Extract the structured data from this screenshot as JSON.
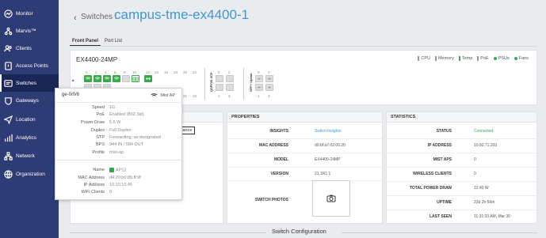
{
  "sidebar": {
    "items": [
      {
        "label": "Monitor",
        "icon": "monitor-icon",
        "active": false
      },
      {
        "label": "Marvis™",
        "icon": "marvis-icon",
        "active": false
      },
      {
        "label": "Clients",
        "icon": "clients-icon",
        "active": false
      },
      {
        "label": "Access Points",
        "icon": "access-points-icon",
        "active": false
      },
      {
        "label": "Switches",
        "icon": "switches-icon",
        "active": true
      },
      {
        "label": "Gateways",
        "icon": "gateways-icon",
        "active": false
      },
      {
        "label": "Location",
        "icon": "location-icon",
        "active": false
      },
      {
        "label": "Analytics",
        "icon": "analytics-icon",
        "active": false
      },
      {
        "label": "Network",
        "icon": "network-icon",
        "active": false
      },
      {
        "label": "Organization",
        "icon": "organization-icon",
        "active": false
      }
    ]
  },
  "header": {
    "breadcrumb": "Switches :",
    "title": "campus-tme-ex4400-1"
  },
  "tabs": [
    {
      "label": "Front Panel",
      "active": true
    },
    {
      "label": "Port List",
      "active": false
    }
  ],
  "front_panel": {
    "model": "EX4400-24MP",
    "legend": {
      "cpu": "CPU",
      "memory": "Memory",
      "temp": "Temp",
      "poe": "PoE",
      "psus": "PSUs",
      "fans": "Fans"
    },
    "top_port_numbers": [
      "0",
      "2",
      "4",
      "6",
      "8",
      "10",
      "12",
      "14",
      "16",
      "18",
      "20",
      "22"
    ],
    "bottom_port_numbers": [
      "21",
      "23"
    ],
    "qsfp_label": "QSFP28 VCP",
    "qsfp_top": [
      "0",
      "2"
    ],
    "qsfp_bottom": [
      "1",
      "3"
    ],
    "sfp_label": "SFP+ Uplink",
    "sfp_top": [
      "0",
      "2"
    ],
    "sfp_bottom": [
      "1",
      "3"
    ],
    "side_letter": "a"
  },
  "properties": {
    "title": "PROPERTIES",
    "rows": [
      {
        "label": "INSIGHTS",
        "value": "Switch Insights"
      },
      {
        "label": "MAC ADDRESS",
        "value": "d0:bf:a7:02:00:20"
      },
      {
        "label": "MODEL",
        "value": "EX4400-24MP"
      },
      {
        "label": "VERSION",
        "value": "21.1R1.1"
      },
      {
        "label": "SWITCH PHOTOS",
        "value": ""
      }
    ]
  },
  "statistics": {
    "title": "STATISTICS",
    "rows": [
      {
        "label": "STATUS",
        "value": "Connected"
      },
      {
        "label": "IP ADDRESS",
        "value": "10.92.71.203"
      },
      {
        "label": "MIST APS",
        "value": "0"
      },
      {
        "label": "WIRELESS CLIENTS",
        "value": "0"
      },
      {
        "label": "TOTAL POWER DRAW",
        "value": "12.40 W"
      },
      {
        "label": "UPTIME",
        "value": "22d 2h 56m"
      },
      {
        "label": "LAST SEEN",
        "value": "11:31:33 AM, Mar 30"
      }
    ]
  },
  "left_card": {
    "compliance_label": "pliance"
  },
  "tooltip": {
    "port": "ge-0/0/6",
    "device_type": "Mist AP",
    "port_rows": [
      {
        "label": "Speed",
        "value": "1G"
      },
      {
        "label": "PoE",
        "value": "Enabled (802.3at)"
      },
      {
        "label": "Power Draw",
        "value": "5.6 W"
      },
      {
        "label": "Duplex",
        "value": "Full Duplex"
      },
      {
        "label": "STP",
        "value": "Forwarding, as designated"
      },
      {
        "label": "BPS",
        "value": "944 IN / 584 OUT"
      },
      {
        "label": "Profile",
        "value": "mist-ap"
      }
    ],
    "ap_rows": [
      {
        "label": "Name",
        "value": "AP12"
      },
      {
        "label": "MAC Address",
        "value": "d4:20:b0:85:ff:9f"
      },
      {
        "label": "IP Address",
        "value": "10.10.10.45"
      },
      {
        "label": "WiFi Clients",
        "value": "0"
      }
    ]
  },
  "footer": {
    "section_title": "Switch Configuration"
  },
  "colors": {
    "sidebar": "#2d3c74",
    "accent": "#3a9ad9",
    "port_up": "#37a94a"
  }
}
